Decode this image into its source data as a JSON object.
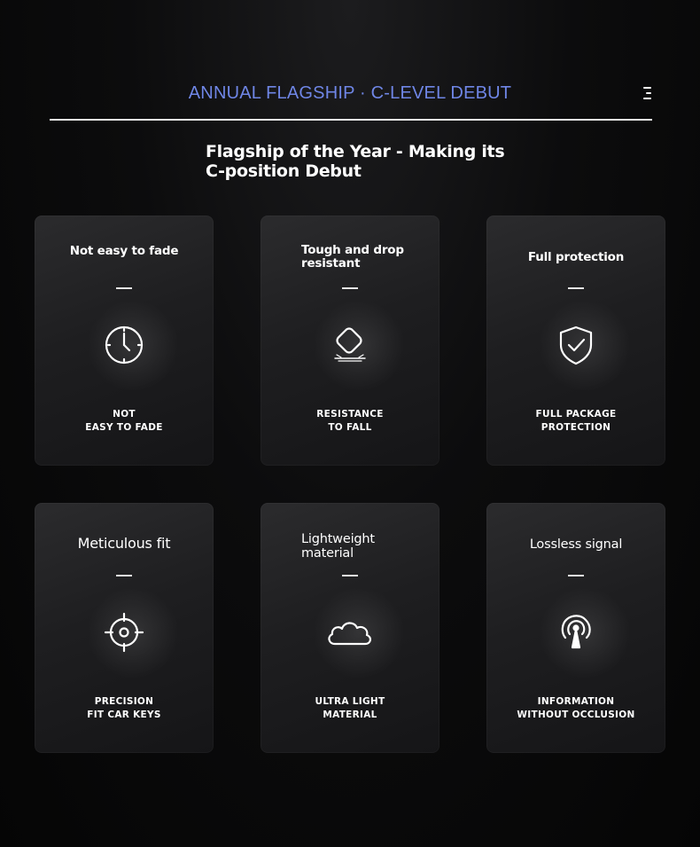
{
  "banner": {
    "text": "ANNUAL FLAGSHIP · C-LEVEL DEBUT",
    "color": "#6f86e6"
  },
  "menu": {
    "icon": "menu-icon"
  },
  "headline": {
    "text": "Flagship of the Year - Making its C-position Debut"
  },
  "cards": [
    {
      "title": "Not easy to fade",
      "icon": "clock-icon",
      "caption_line1": "NOT",
      "caption_line2": "EASY TO FADE"
    },
    {
      "title": "Tough and drop resistant",
      "icon": "drop-resistant-icon",
      "caption_line1": "RESISTANCE",
      "caption_line2": "TO FALL"
    },
    {
      "title": "Full protection",
      "icon": "shield-check-icon",
      "caption_line1": "FULL PACKAGE",
      "caption_line2": "PROTECTION"
    },
    {
      "title": "Meticulous fit",
      "icon": "crosshair-icon",
      "caption_line1": "PRECISION",
      "caption_line2": "FIT CAR KEYS"
    },
    {
      "title": "Lightweight material",
      "icon": "cloud-icon",
      "caption_line1": "ULTRA LIGHT",
      "caption_line2": "MATERIAL"
    },
    {
      "title": "Lossless signal",
      "icon": "signal-tower-icon",
      "caption_line1": "INFORMATION",
      "caption_line2": "WITHOUT OCCLUSION"
    }
  ]
}
